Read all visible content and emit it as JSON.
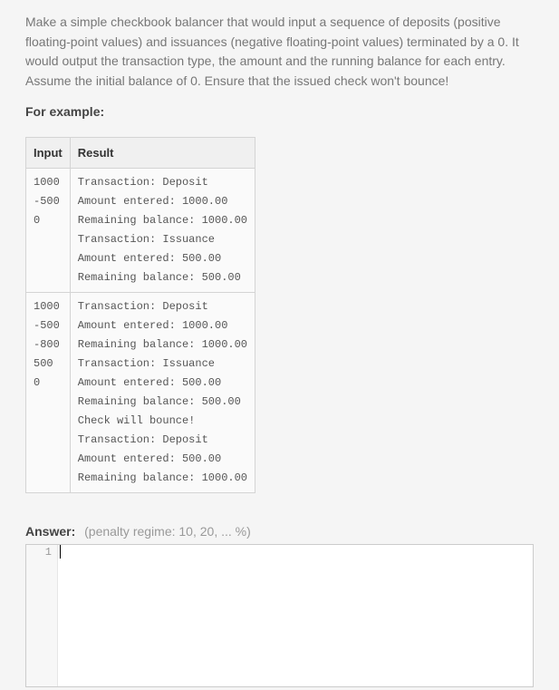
{
  "prompt": "Make a simple checkbook balancer that would input a sequence of deposits (positive floating-point values) and issuances (negative floating-point values) terminated by a 0. It would output the transaction type, the amount and the running balance for each entry. Assume the initial balance of 0. Ensure that the issued check won't bounce!",
  "example_label": "For example:",
  "table": {
    "headers": [
      "Input",
      "Result"
    ],
    "rows": [
      {
        "input": "1000\n-500\n0",
        "result": "Transaction: Deposit\nAmount entered: 1000.00\nRemaining balance: 1000.00\nTransaction: Issuance\nAmount entered: 500.00\nRemaining balance: 500.00"
      },
      {
        "input": "1000\n-500\n-800\n500\n0",
        "result": "Transaction: Deposit\nAmount entered: 1000.00\nRemaining balance: 1000.00\nTransaction: Issuance\nAmount entered: 500.00\nRemaining balance: 500.00\nCheck will bounce!\nTransaction: Deposit\nAmount entered: 500.00\nRemaining balance: 1000.00"
      }
    ]
  },
  "answer": {
    "label": "Answer:",
    "penalty": "(penalty regime: 10, 20, ... %)"
  },
  "editor": {
    "line_number": "1",
    "value": ""
  }
}
